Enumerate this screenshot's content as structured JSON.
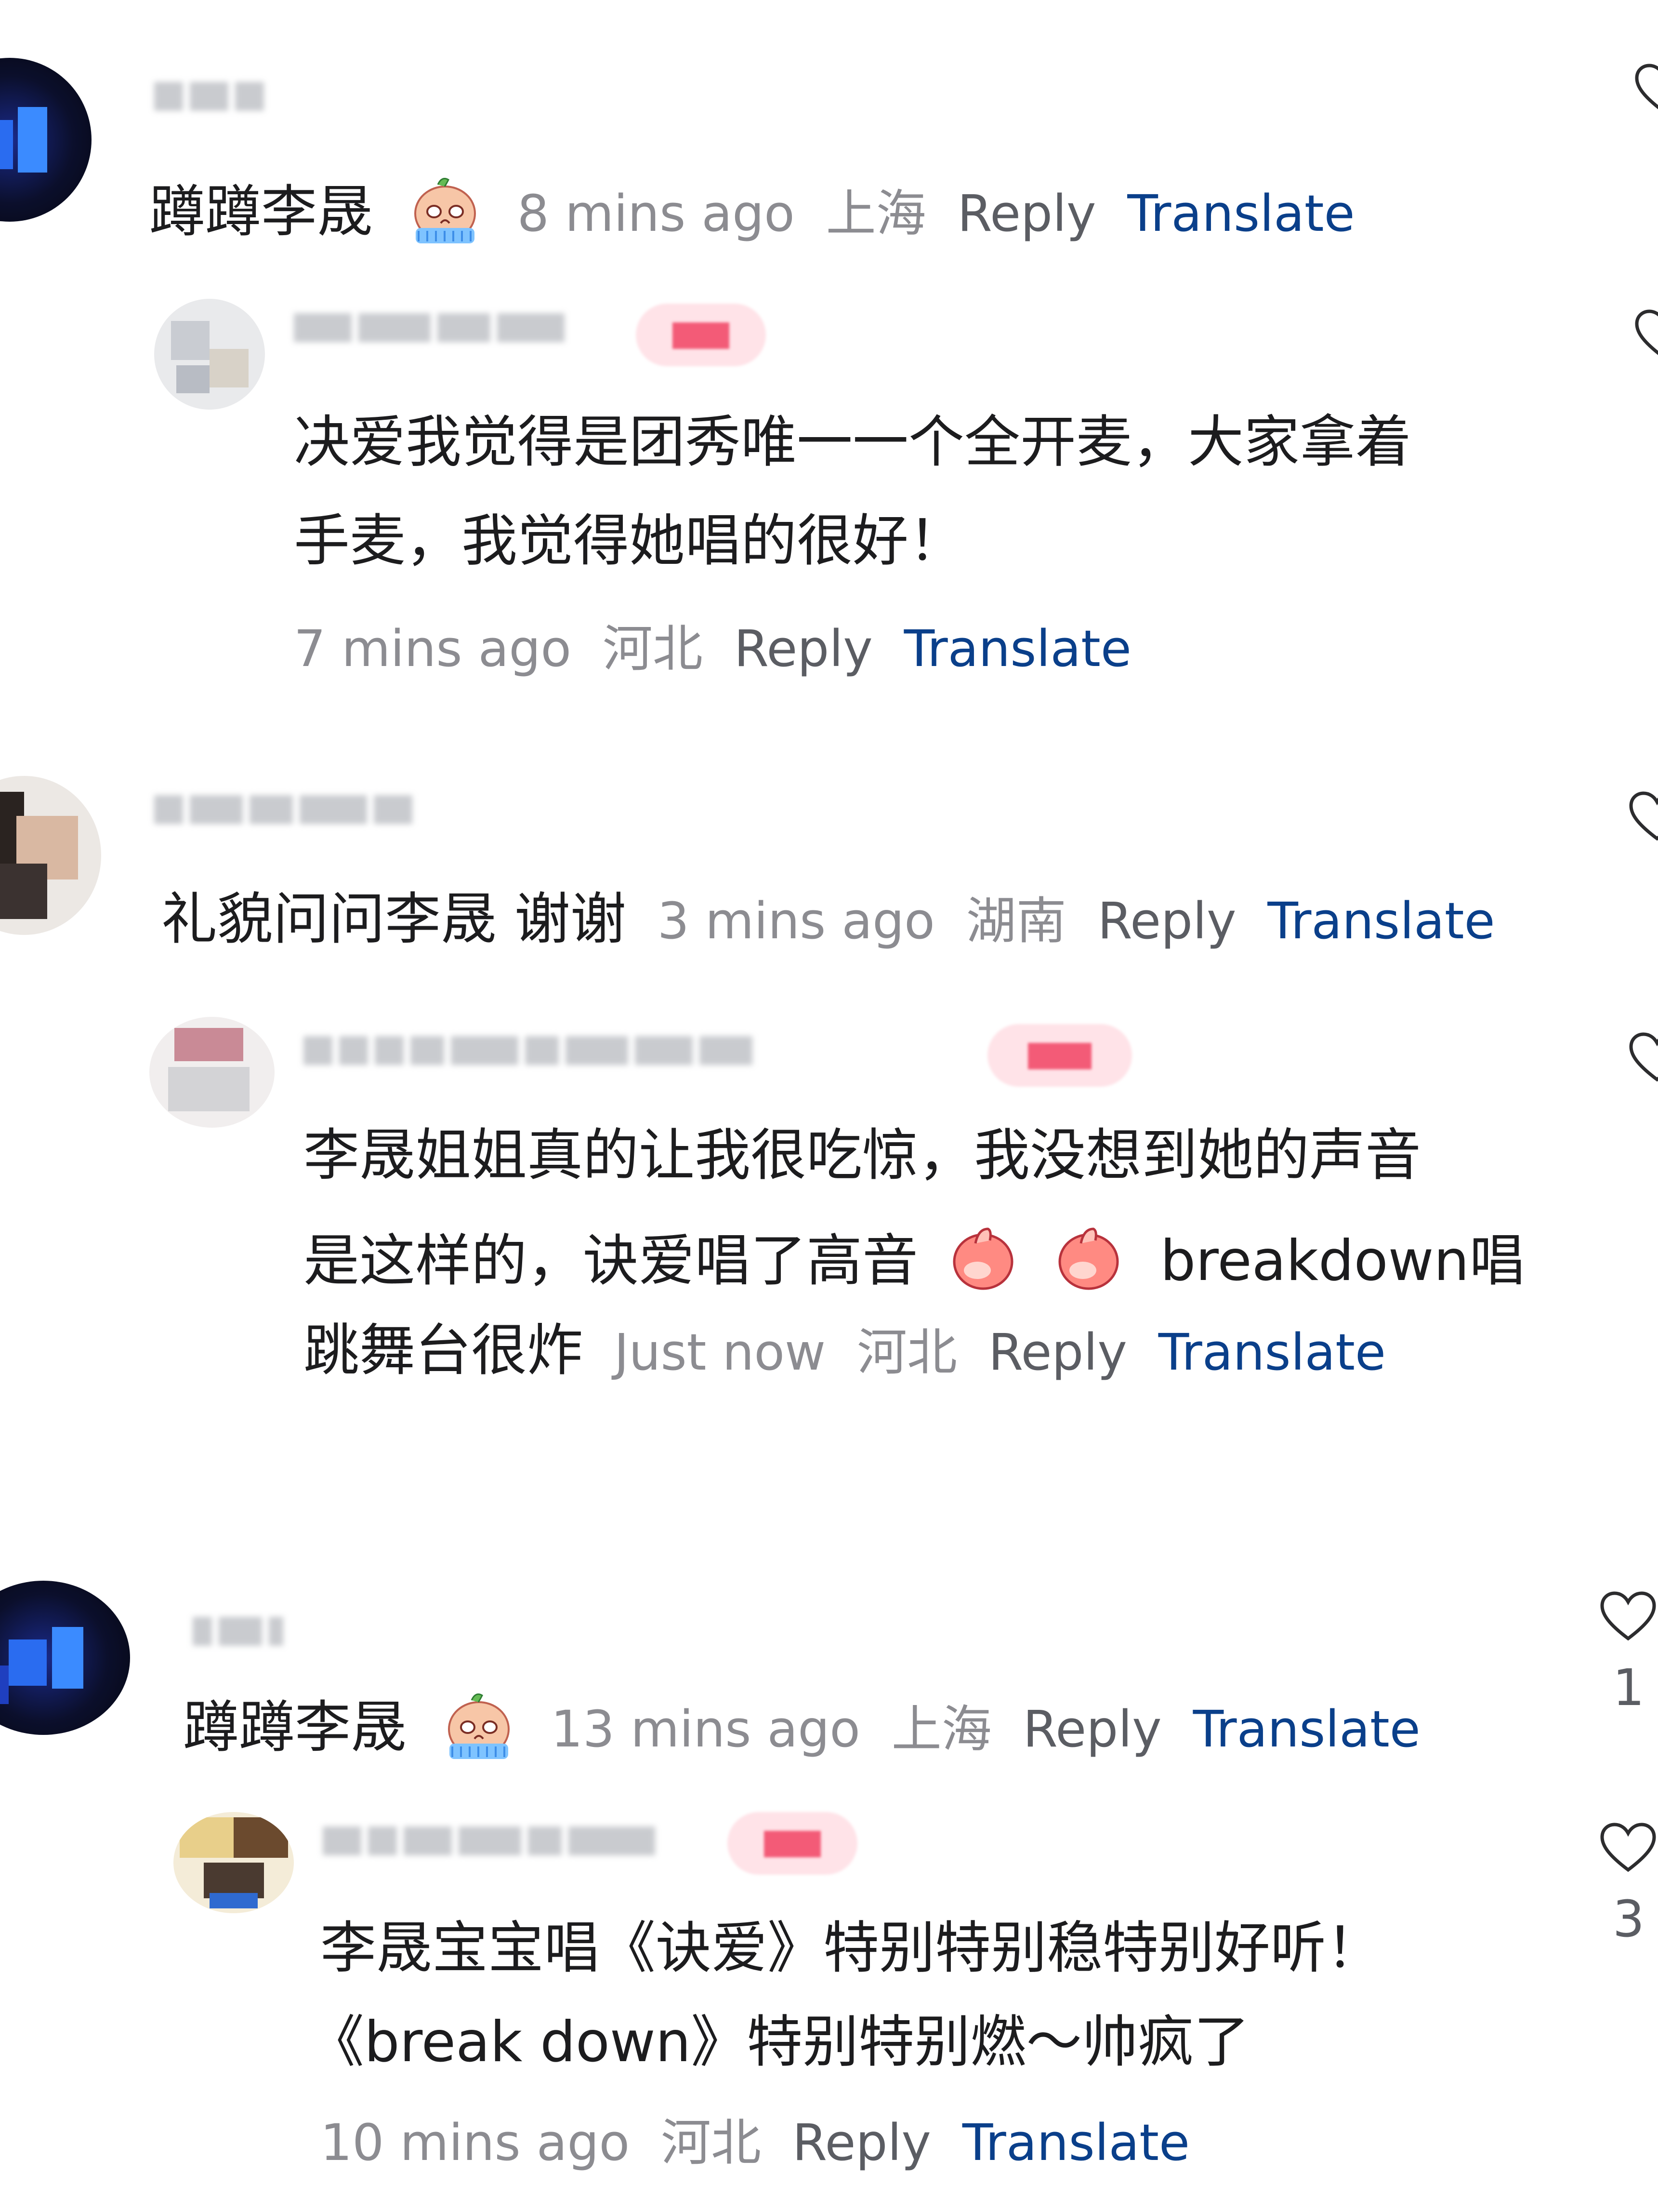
{
  "comments": [
    {
      "id": "c1",
      "text": "蹲蹲李晟",
      "emoji": "crying-face-emoji",
      "time": "8 mins ago",
      "location": "上海",
      "reply_label": "Reply",
      "translate_label": "Translate"
    },
    {
      "id": "c1-reply",
      "line1": "决爱我觉得是团秀唯一一个全开麦，大家拿着",
      "line2": "手麦，我觉得她唱的很好！",
      "time": "7 mins ago",
      "location": "河北",
      "reply_label": "Reply",
      "translate_label": "Translate"
    },
    {
      "id": "c2",
      "text": "礼貌问问李晟 谢谢",
      "time": "3 mins ago",
      "location": "湖南",
      "reply_label": "Reply",
      "translate_label": "Translate"
    },
    {
      "id": "c2-reply",
      "line1": "李晟姐姐真的让我很吃惊，我没想到她的声音",
      "line2_prefix": "是这样的，诀爱唱了高音",
      "line2_suffix": "breakdown唱",
      "line3": "跳舞台很炸",
      "emoji": "thumbs-up-emoji",
      "time": "Just now",
      "location": "河北",
      "reply_label": "Reply",
      "translate_label": "Translate"
    },
    {
      "id": "c3",
      "text": "蹲蹲李晟",
      "emoji": "crying-face-emoji",
      "time": "13 mins ago",
      "location": "上海",
      "reply_label": "Reply",
      "translate_label": "Translate",
      "likes": "1"
    },
    {
      "id": "c3-reply",
      "line1": "李晟宝宝唱《诀爱》特别特别稳特别好听！",
      "line2": "《break down》特别特别燃～帅疯了",
      "time": "10 mins ago",
      "location": "河北",
      "reply_label": "Reply",
      "translate_label": "Translate",
      "likes": "3"
    }
  ],
  "colors": {
    "text": "#1c1c1e",
    "meta": "#8c8c91",
    "translate": "#0a3f8a",
    "author_badge": "#f35b77"
  },
  "icons": [
    "heart-icon"
  ]
}
